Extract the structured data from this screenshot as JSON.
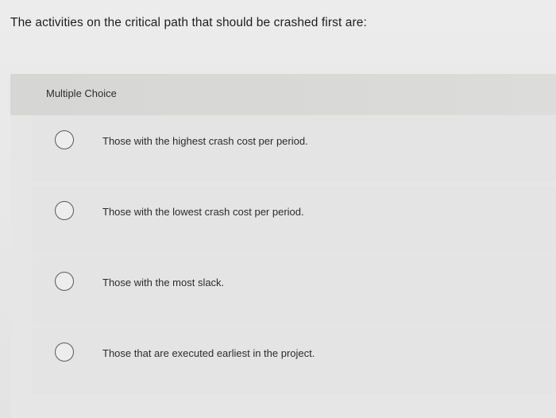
{
  "question": {
    "text": "The activities on the critical path that should be crashed first are:"
  },
  "multiple_choice": {
    "label": "Multiple Choice",
    "options": [
      {
        "label": "Those with the highest crash cost per period."
      },
      {
        "label": "Those with the lowest crash cost per period."
      },
      {
        "label": "Those with the most slack."
      },
      {
        "label": "Those that are executed earliest in the project."
      }
    ]
  }
}
